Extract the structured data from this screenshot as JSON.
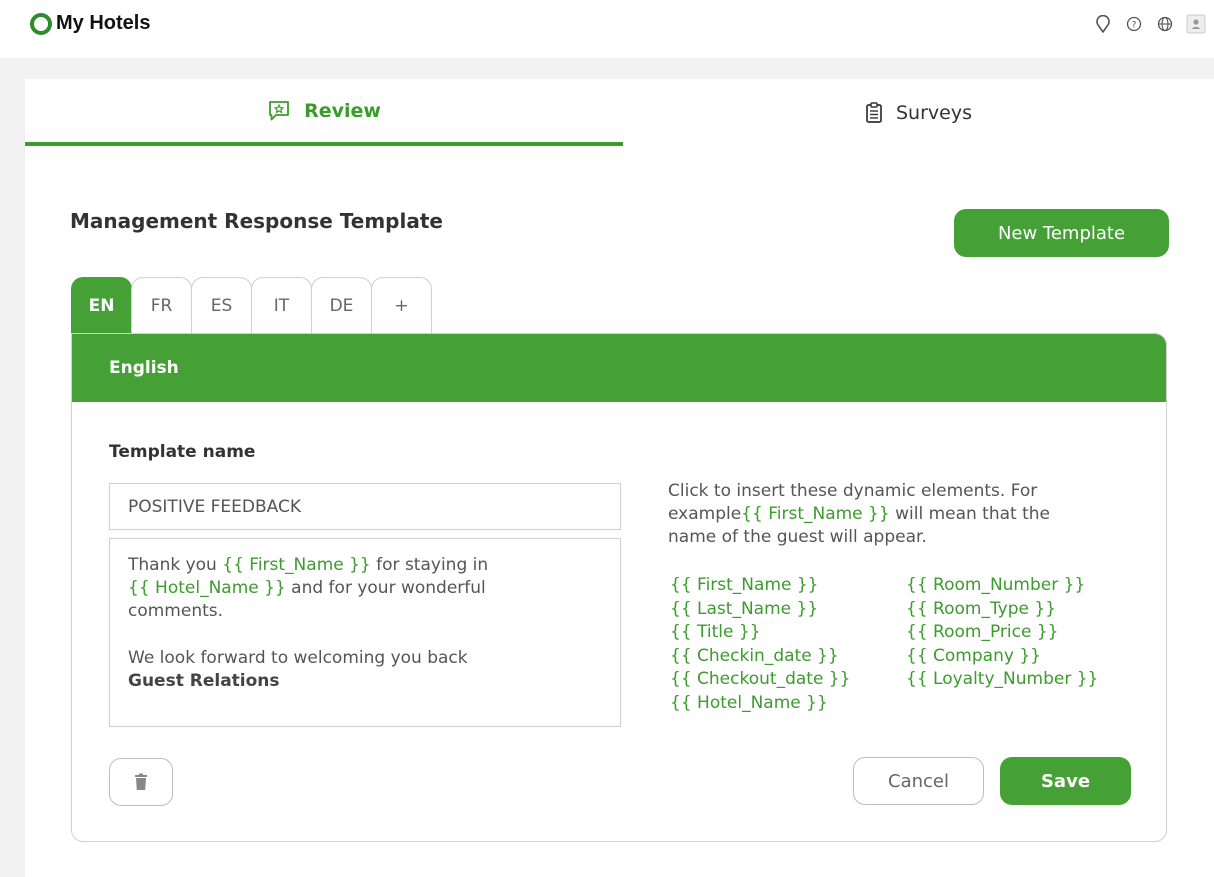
{
  "app": {
    "title": "My Hotels"
  },
  "top_icons": [
    "location-pin-icon",
    "help-icon",
    "globe-icon",
    "user-avatar-icon"
  ],
  "tabs": [
    {
      "label": "Review",
      "icon": "review-chat-icon",
      "active": true
    },
    {
      "label": "Surveys",
      "icon": "clipboard-icon",
      "active": false
    }
  ],
  "page": {
    "title": "Management Response Template",
    "new_template_label": "New Template"
  },
  "languages": {
    "tabs": [
      "EN",
      "FR",
      "ES",
      "IT",
      "DE",
      "+"
    ],
    "active": "EN",
    "active_name": "English"
  },
  "form": {
    "name_label": "Template name",
    "name_value": "POSITIVE FEEDBACK",
    "body": {
      "l1_a": "Thank you ",
      "l1_var": "{{ First_Name }}",
      "l1_b": " for staying in",
      "l2_var": "{{ Hotel_Name }}",
      "l2_b": " and for your wonderful",
      "l3": "comments.",
      "l4": "We look forward to welcoming you back",
      "l5": "Guest Relations"
    },
    "help": {
      "a": "Click to insert these dynamic elements. For example",
      "var": "{{ First_Name }}",
      "b": " will mean that the name of the guest will appear."
    },
    "variables_col1": [
      "{{ First_Name }}",
      "{{ Last_Name }}",
      "{{ Title }}",
      "{{ Checkin_date }}",
      "{{ Checkout_date }}",
      "{{ Hotel_Name }}"
    ],
    "variables_col2": [
      "{{ Room_Number }}",
      "{{ Room_Type }}",
      "{{ Room_Price }}",
      "{{ Company }}",
      "{{ Loyalty_Number }}"
    ],
    "cancel_label": "Cancel",
    "save_label": "Save"
  },
  "colors": {
    "accent": "#45a035",
    "accent_text": "#3c9b2d"
  }
}
